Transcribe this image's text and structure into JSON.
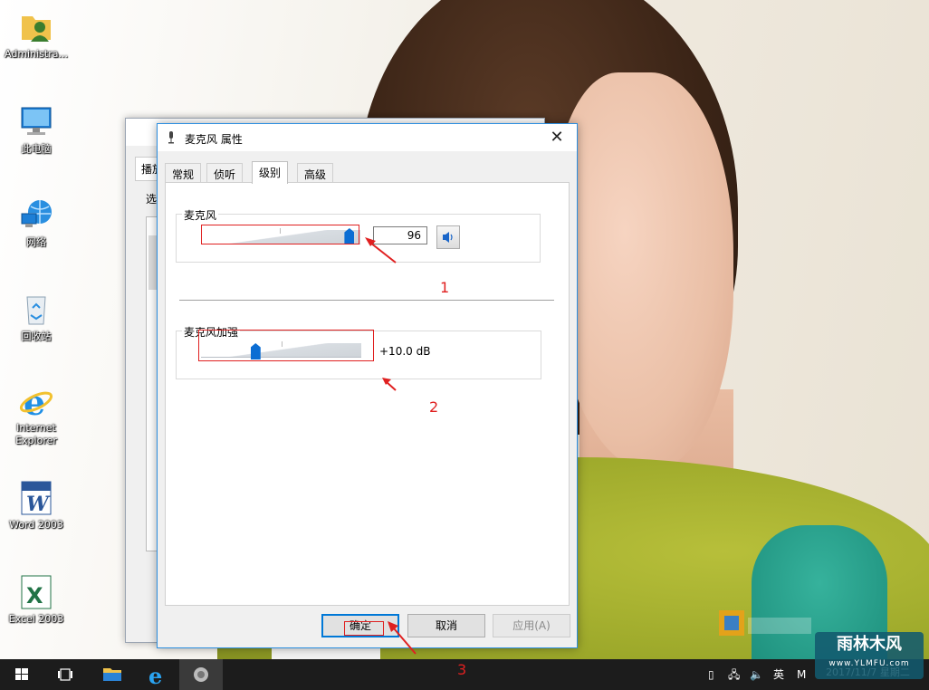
{
  "desktop": {
    "icons": [
      {
        "label": "Administra..."
      },
      {
        "label": "此电脑"
      },
      {
        "label": "网络"
      },
      {
        "label": "回收站"
      },
      {
        "label_line1": "Internet",
        "label_line2": "Explorer"
      },
      {
        "label": "Word 2003"
      },
      {
        "label": "Excel 2003"
      }
    ]
  },
  "background_window": {
    "tab_partial": "播放",
    "text_partial": "选"
  },
  "dialog": {
    "title": "麦克风 属性",
    "tabs": [
      {
        "label": "常规"
      },
      {
        "label": "侦听"
      },
      {
        "label": "级别"
      },
      {
        "label": "高级"
      }
    ],
    "active_tab": "级别",
    "microphone": {
      "label": "麦克风",
      "value": "96",
      "level": 96
    },
    "boost": {
      "label": "麦克风加强",
      "value": "+10.0 dB",
      "level": 0.33
    },
    "buttons": {
      "ok": "确定",
      "cancel": "取消",
      "apply": "应用(A)"
    }
  },
  "annotations": {
    "a1": "1",
    "a2": "2",
    "a3": "3",
    "color": "#e02020"
  },
  "taskbar": {
    "language": "英",
    "ime": "M",
    "date_partial": "2017/11/7 星期二"
  },
  "watermark": {
    "line1": "雨林木风",
    "line2": "www.YLMFU.com"
  },
  "colors": {
    "accent": "#0078d7",
    "thumb": "#0b6dd3",
    "taskbar": "#1c1c1c"
  }
}
